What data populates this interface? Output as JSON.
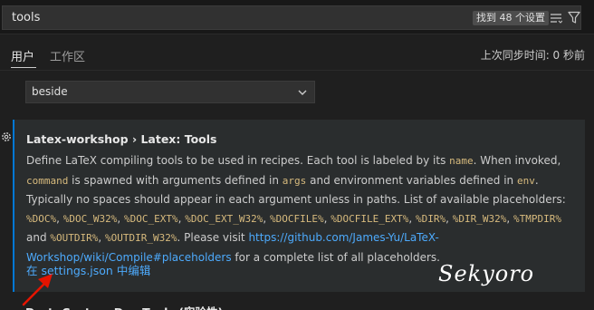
{
  "search": {
    "value": "tools",
    "result_badge": "找到 48 个设置"
  },
  "tabs": [
    {
      "label": "用户",
      "active": true
    },
    {
      "label": "工作区",
      "active": false
    }
  ],
  "sync_status": "上次同步时间: 0 秒前",
  "previous_setting": {
    "dropdown_value": "beside"
  },
  "setting": {
    "title": "Latex-workshop › Latex: Tools",
    "description": {
      "t1": "Define LaTeX compiling tools to be used in recipes. Each tool is labeled by its ",
      "c_name": "name",
      "t2": ". When invoked, ",
      "c_command": "command",
      "t3": " is spawned with arguments defined in ",
      "c_args": "args",
      "t4": " and environment variables defined in ",
      "c_env": "env",
      "t5": ". Typically no spaces should appear in each argument unless in paths. List of available placeholders: ",
      "c_doc": "%DOC%",
      "s1": ", ",
      "c_doc_w32": "%DOC_W32%",
      "s2": ", ",
      "c_doc_ext": "%DOC_EXT%",
      "s3": ", ",
      "c_doc_ext_w32": "%DOC_EXT_W32%",
      "s4": ", ",
      "c_docfile": "%DOCFILE%",
      "s5": ", ",
      "c_docfile_ext": "%DOCFILE_EXT%",
      "s6": ", ",
      "c_dir": "%DIR%",
      "s7": ", ",
      "c_dir_w32": "%DIR_W32%",
      "s8": ", ",
      "c_tmpdir": "%TMPDIR%",
      "s9": " and ",
      "c_outdir": "%OUTDIR%",
      "s10": ", ",
      "c_outdir_w32": "%OUTDIR_W32%",
      "t6": ". Please visit ",
      "link": "https://github.com/James-Yu/LaTeX-Workshop/wiki/Compile#placeholders",
      "t7": " for a complete list of all placeholders."
    },
    "edit_link": "在 settings.json 中编辑"
  },
  "next_setting": {
    "title": "Dart: Custom Dev Tools (实验性)"
  },
  "watermark": "Sekyoro",
  "colors": {
    "accent": "#0078d4",
    "link": "#4daafc",
    "code": "#d7ba7d",
    "arrow": "#e51400"
  },
  "icons": [
    "filter-list-icon",
    "filter-funnel-icon",
    "chevron-down-icon",
    "gear-icon"
  ]
}
